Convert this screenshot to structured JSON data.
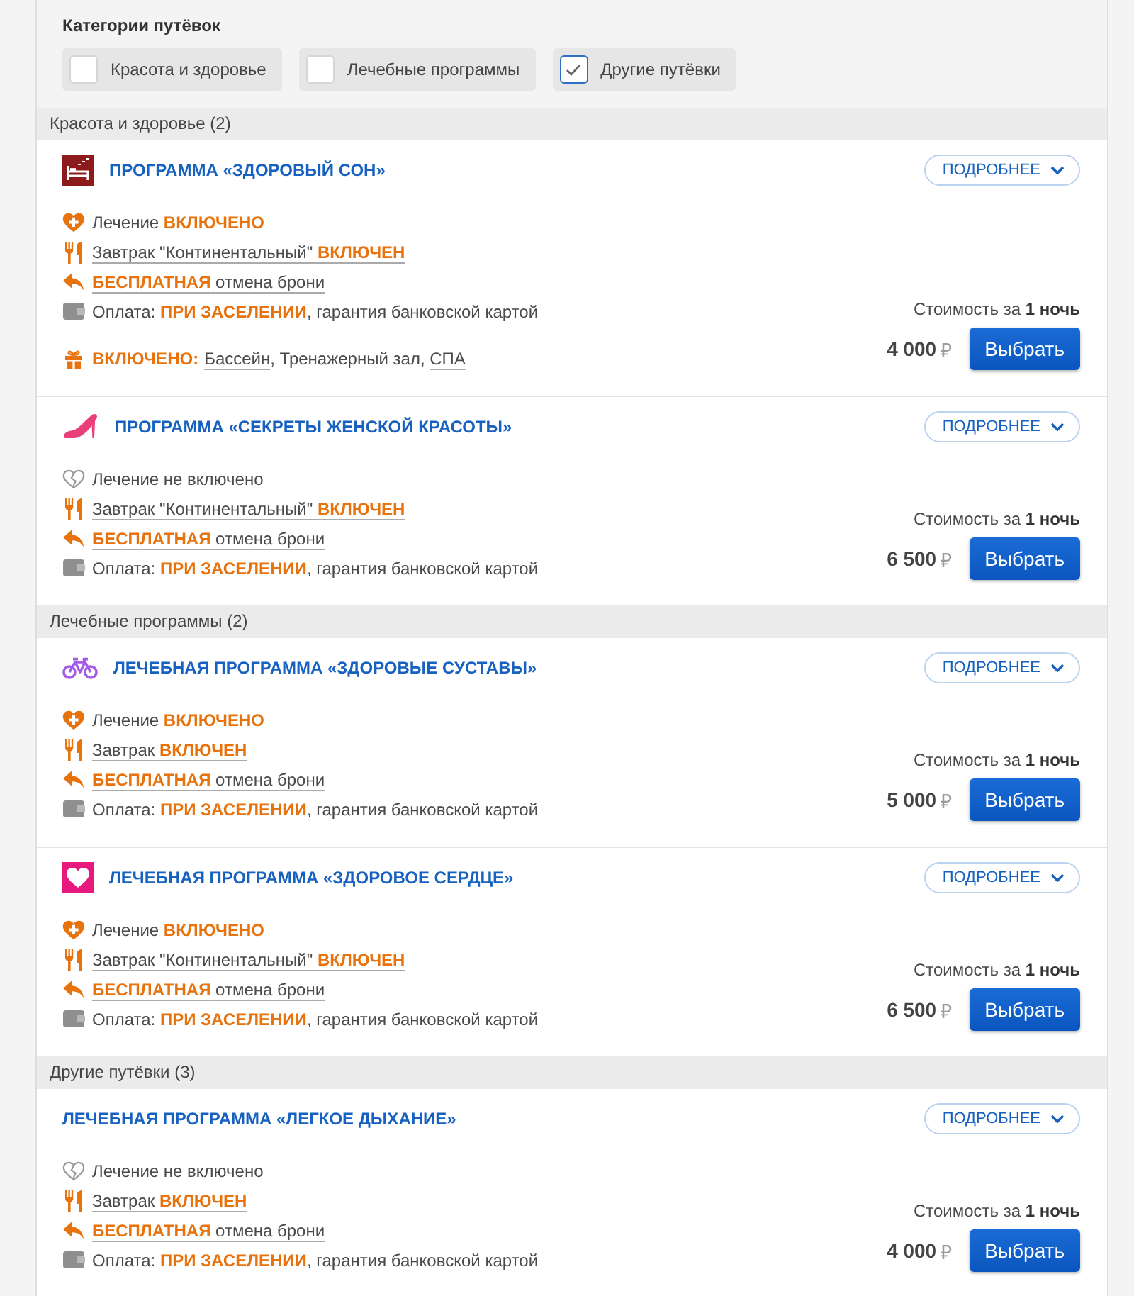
{
  "filter": {
    "title": "Категории путёвок",
    "options": [
      {
        "label": "Красота и здоровье",
        "checked": false
      },
      {
        "label": "Лечебные программы",
        "checked": false
      },
      {
        "label": "Другие путёвки",
        "checked": true
      }
    ]
  },
  "groups": [
    {
      "heading": "Красота и здоровье (2)",
      "programs": [
        {
          "kind": "sleep",
          "title": "ПРОГРАММА «ЗДОРОВЫЙ СОН»",
          "details_button": "ПОДРОБНЕЕ",
          "features": [
            {
              "kind": "treatment",
              "included": true,
              "text": "Лечение **ВКЛЮЧЕНО**"
            },
            {
              "kind": "breakfast",
              "text": "Завтрак \"Континентальный\" **ВКЛЮЧЕН**"
            },
            {
              "kind": "cancellation",
              "text": "**БЕСПЛАТНАЯ** отмена брони"
            },
            {
              "kind": "payment",
              "text": "Оплата: **ПРИ ЗАСЕЛЕНИИ**, гарантия банковской картой"
            }
          ],
          "amenities": {
            "label": "ВКЛЮЧЕНО:",
            "items": [
              {
                "kind": "link",
                "text": "Бассейн"
              },
              {
                "kind": "plain",
                "text": ", Тренажерный зал, "
              },
              {
                "kind": "link",
                "text": "СПА"
              }
            ]
          },
          "price_caption": "Стоимость за **1 ночь**",
          "price": "4 000",
          "currency": "₽",
          "select_button": "Выбрать"
        },
        {
          "kind": "beauty",
          "title": "ПРОГРАММА «СЕКРЕТЫ ЖЕНСКОЙ КРАСОТЫ»",
          "details_button": "ПОДРОБНЕЕ",
          "features": [
            {
              "kind": "treatment",
              "included": false,
              "text": "Лечение не включено"
            },
            {
              "kind": "breakfast",
              "text": "Завтрак \"Континентальный\" **ВКЛЮЧЕН**"
            },
            {
              "kind": "cancellation",
              "text": "**БЕСПЛАТНАЯ** отмена брони"
            },
            {
              "kind": "payment",
              "text": "Оплата: **ПРИ ЗАСЕЛЕНИИ**, гарантия банковской картой"
            }
          ],
          "price_caption": "Стоимость за **1 ночь**",
          "price": "6 500",
          "currency": "₽",
          "select_button": "Выбрать"
        }
      ]
    },
    {
      "heading": "Лечебные программы (2)",
      "programs": [
        {
          "kind": "joints",
          "title": "ЛЕЧЕБНАЯ ПРОГРАММА «ЗДОРОВЫЕ СУСТАВЫ»",
          "details_button": "ПОДРОБНЕЕ",
          "features": [
            {
              "kind": "treatment",
              "included": true,
              "text": "Лечение **ВКЛЮЧЕНО**"
            },
            {
              "kind": "breakfast",
              "text": "Завтрак **ВКЛЮЧЕН**"
            },
            {
              "kind": "cancellation",
              "text": "**БЕСПЛАТНАЯ** отмена брони"
            },
            {
              "kind": "payment",
              "text": "Оплата: **ПРИ ЗАСЕЛЕНИИ**, гарантия банковской картой"
            }
          ],
          "price_caption": "Стоимость за **1 ночь**",
          "price": "5 000",
          "currency": "₽",
          "select_button": "Выбрать"
        },
        {
          "kind": "cardio",
          "title": "ЛЕЧЕБНАЯ ПРОГРАММА «ЗДОРОВОЕ СЕРДЦЕ»",
          "details_button": "ПОДРОБНЕЕ",
          "features": [
            {
              "kind": "treatment",
              "included": true,
              "text": "Лечение **ВКЛЮЧЕНО**"
            },
            {
              "kind": "breakfast",
              "text": "Завтрак \"Континентальный\" **ВКЛЮЧЕН**"
            },
            {
              "kind": "cancellation",
              "text": "**БЕСПЛАТНАЯ** отмена брони"
            },
            {
              "kind": "payment",
              "text": "Оплата: **ПРИ ЗАСЕЛЕНИИ**, гарантия банковской картой"
            }
          ],
          "price_caption": "Стоимость за **1 ночь**",
          "price": "6 500",
          "currency": "₽",
          "select_button": "Выбрать"
        }
      ]
    },
    {
      "heading": "Другие путёвки (3)",
      "programs": [
        {
          "kind": "other",
          "title": "ЛЕЧЕБНАЯ ПРОГРАММА «ЛЕГКОЕ ДЫХАНИЕ»",
          "details_button": "ПОДРОБНЕЕ",
          "features": [
            {
              "kind": "treatment",
              "included": false,
              "text": "Лечение не включено"
            },
            {
              "kind": "breakfast",
              "text": "Завтрак **ВКЛЮЧЕН**"
            },
            {
              "kind": "cancellation",
              "text": "**БЕСПЛАТНАЯ** отмена брони"
            },
            {
              "kind": "payment",
              "text": "Оплата: **ПРИ ЗАСЕЛЕНИИ**, гарантия банковской картой"
            }
          ],
          "price_caption": "Стоимость за **1 ночь**",
          "price": "4 000",
          "currency": "₽",
          "select_button": "Выбрать"
        }
      ]
    }
  ]
}
